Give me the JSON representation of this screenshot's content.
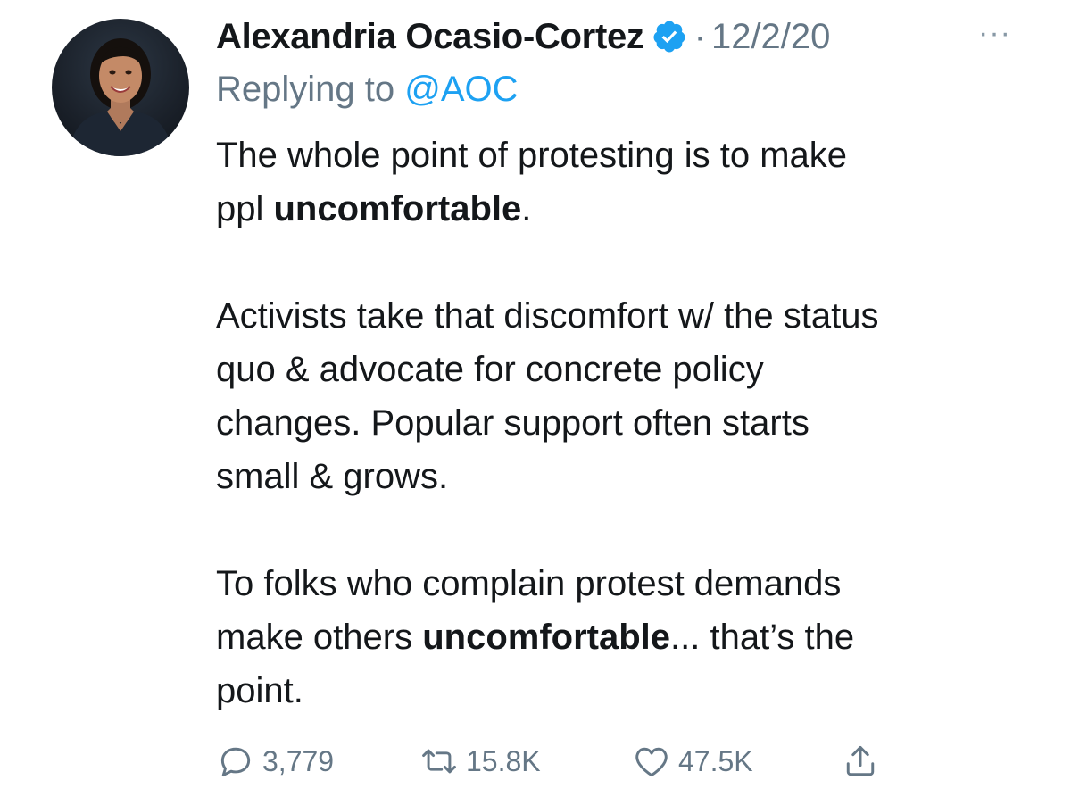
{
  "tweet": {
    "author_name": "Alexandria Ocasio-Cortez",
    "separator": "·",
    "date": "12/2/20",
    "more": "···",
    "replying_prefix": "Replying to ",
    "replying_handle": "@AOC",
    "paragraphs": [
      {
        "line1": "The whole point of protesting is to make",
        "line2_before": "ppl ",
        "line2_bold": "uncomfortable",
        "line2_after": "."
      },
      {
        "lines": [
          "Activists take that discomfort w/ the status",
          "quo & advocate for concrete policy",
          "changes. Popular support often starts",
          "small & grows."
        ]
      },
      {
        "line1": "To folks who complain protest demands",
        "line2_before": "make others ",
        "line2_bold": "uncomfortable",
        "line2_after": "... that’s the",
        "line3": "point."
      }
    ],
    "stats": {
      "replies": "3,779",
      "retweets": "15.8K",
      "likes": "47.5K"
    },
    "icons": {
      "verified": "verified-badge-icon",
      "reply": "reply-bubble-icon",
      "retweet": "retweet-icon",
      "like": "heart-icon",
      "share": "share-icon",
      "more": "more-dots-icon"
    },
    "colors": {
      "text": "#14171a",
      "muted": "#657786",
      "accent": "#1da1f2"
    }
  }
}
